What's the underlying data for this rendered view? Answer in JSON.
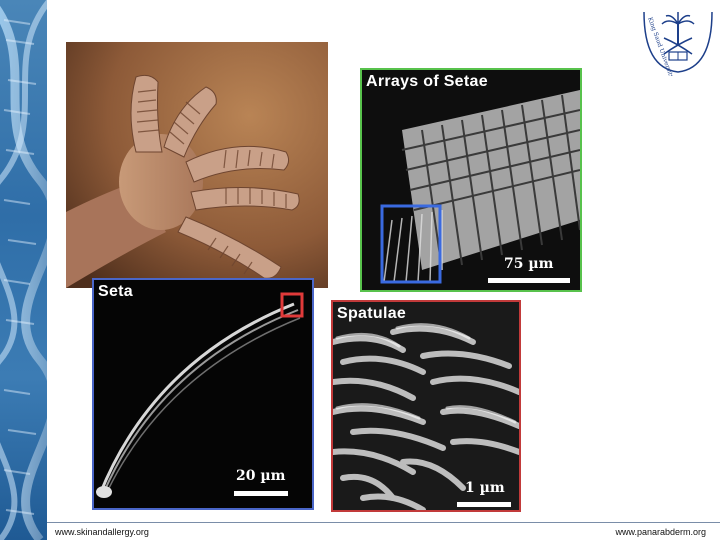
{
  "seal": {
    "arabic_text": "جامعة الملك سعود",
    "english_text": "King Saud University"
  },
  "panels": {
    "gecko_photo": {
      "subject": "gecko foot with toe pads"
    },
    "setae_array": {
      "title": "Arrays of Setae",
      "scale": "75 µm",
      "border_color": "#58c24c"
    },
    "seta": {
      "title": "Seta",
      "scale": "20 µm",
      "border_color": "#4a66c8"
    },
    "spatulae": {
      "title": "Spatulae",
      "scale": "1 µm",
      "border_color": "#c23a3a"
    }
  },
  "footer": {
    "left": "www.skinandallergy.org",
    "right": "www.panarabderm.org"
  }
}
